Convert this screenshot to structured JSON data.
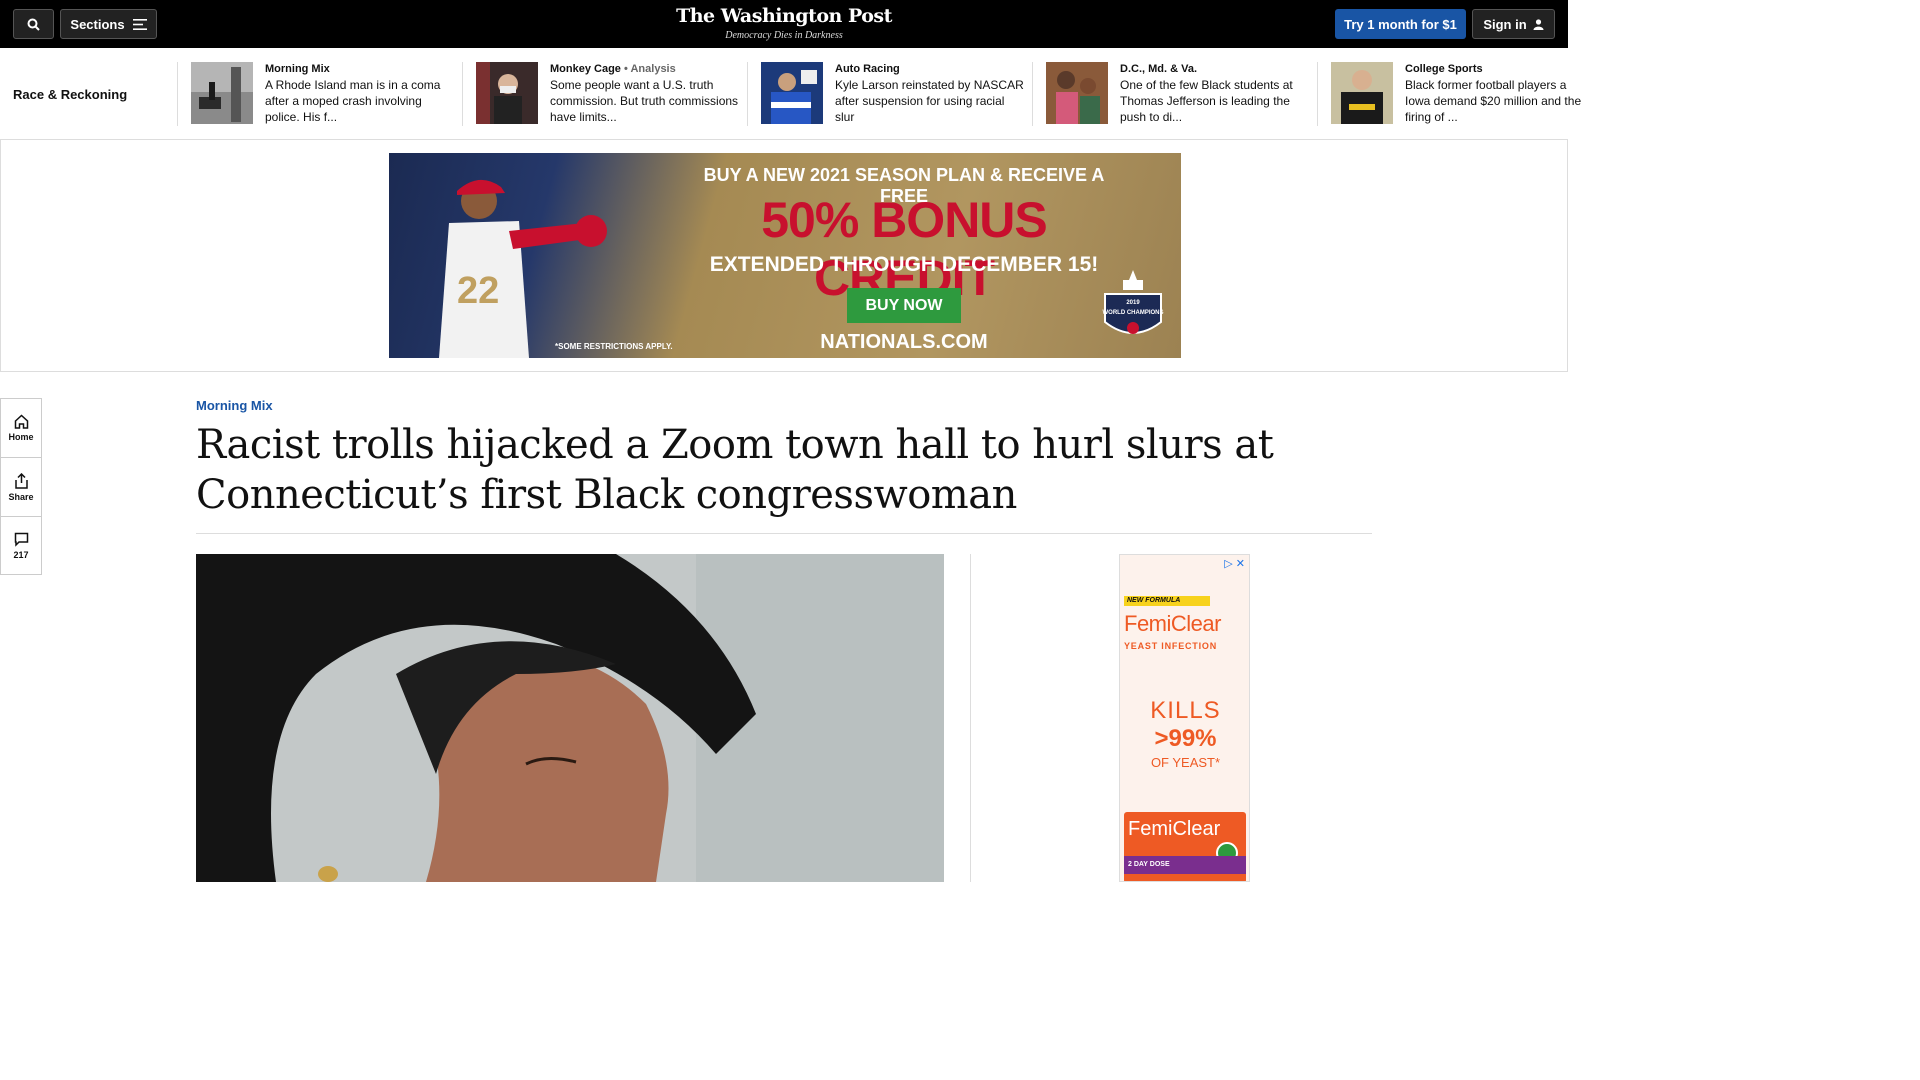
{
  "topbar": {
    "search_icon": "search-icon",
    "sections_label": "Sections",
    "masthead_title": "The Washington Post",
    "masthead_tagline": "Democracy Dies in Darkness",
    "try_label": "Try 1 month for $1",
    "signin_label": "Sign in"
  },
  "strip": {
    "title": "Race & Reckoning",
    "items": [
      {
        "kicker": "Morning Mix",
        "analysis": "",
        "headline": "A Rhode Island man is in a coma after a moped crash involving police. His f..."
      },
      {
        "kicker": "Monkey Cage",
        "analysis": "• Analysis",
        "headline": "Some people want a U.S. truth commission. But truth commissions have limits..."
      },
      {
        "kicker": "Auto Racing",
        "analysis": "",
        "headline": "Kyle Larson reinstated by NASCAR after suspension for using racial slur"
      },
      {
        "kicker": "D.C., Md. & Va.",
        "analysis": "",
        "headline": "One of the few Black students at Thomas Jefferson is leading the push to di..."
      },
      {
        "kicker": "College Sports",
        "analysis": "",
        "headline": "Black former football players a Iowa demand $20 million and the firing of ..."
      }
    ]
  },
  "banner_ad": {
    "line1": "BUY A NEW 2021 SEASON PLAN & RECEIVE A FREE",
    "line2": "50% BONUS CREDIT",
    "line3": "EXTENDED THROUGH DECEMBER 15!",
    "button": "BUY NOW",
    "site": "NATIONALS.COM",
    "fine_print": "*SOME RESTRICTIONS APPLY.",
    "jersey_number": "22",
    "badge_year": "2019",
    "badge_text": "WORLD CHAMPIONS"
  },
  "rail": {
    "home_label": "Home",
    "share_label": "Share",
    "comments_count": "217"
  },
  "article": {
    "kicker": "Morning Mix",
    "title": "Racist trolls hijacked a Zoom town hall to hurl slurs at Connecticut’s first Black congresswoman"
  },
  "side_ad": {
    "new_formula": "NEW FORMULA",
    "brand": "FemiClear",
    "subtitle": "YEAST INFECTION",
    "kills": "KILLS",
    "percent": ">99%",
    "of_yeast": "OF YEAST*",
    "pack_dose": "2 DAY DOSE"
  },
  "colors": {
    "accent_blue": "#1955a5",
    "ad_orange": "#ee5a24",
    "nats_red": "#c8102e"
  }
}
